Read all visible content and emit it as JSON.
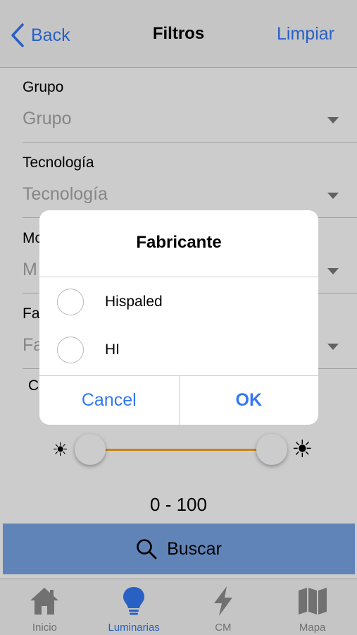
{
  "nav": {
    "back_label": "Back",
    "title": "Filtros",
    "right_label": "Limpiar"
  },
  "fields": [
    {
      "label": "Grupo",
      "placeholder": "Grupo"
    },
    {
      "label": "Tecnología",
      "placeholder": "Tecnología"
    },
    {
      "label": "Mo",
      "placeholder": "M"
    },
    {
      "label": "Fa",
      "placeholder": "Fa"
    }
  ],
  "range": {
    "label": "C",
    "min": 0,
    "max": 100,
    "value_text": "0 - 100",
    "low_icon": "sun-small-icon",
    "high_icon": "sun-large-icon"
  },
  "search_button": {
    "label": "Buscar",
    "icon": "search-icon"
  },
  "tabs": [
    {
      "label": "Inicio",
      "icon": "home-icon",
      "active": false
    },
    {
      "label": "Luminarias",
      "icon": "lightbulb-icon",
      "active": true
    },
    {
      "label": "CM",
      "icon": "lightning-icon",
      "active": false
    },
    {
      "label": "Mapa",
      "icon": "map-icon",
      "active": false
    }
  ],
  "dialog": {
    "title": "Fabricante",
    "options": [
      {
        "label": "Hispaled",
        "selected": false
      },
      {
        "label": "HI",
        "selected": false
      }
    ],
    "cancel_label": "Cancel",
    "ok_label": "OK"
  },
  "colors": {
    "accent": "#3478f6",
    "search_button": "#7aa6e6",
    "slider_track": "#f5a623"
  }
}
